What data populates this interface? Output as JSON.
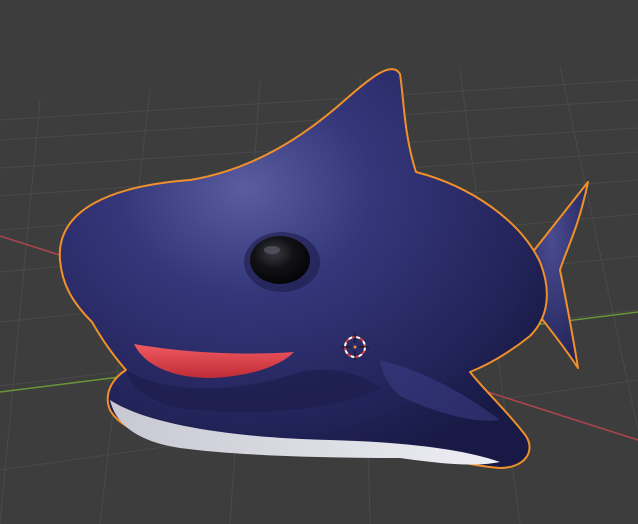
{
  "viewport": {
    "background_color": "#3d3d3d",
    "grid_color": "#4a4a4a",
    "x_axis_color": "#b1454d",
    "y_axis_color": "#6a9638",
    "selection_outline_color": "#f0902a"
  },
  "scene": {
    "object": "shark-model",
    "body_color": "#2a2b66",
    "mouth_color": "#e0404a",
    "belly_color": "#dcdce4",
    "eye_color": "#101014",
    "selected": true
  },
  "cursor": {
    "icon": "3d-cursor-icon",
    "ring_color_a": "#e04040",
    "ring_color_b": "#ffffff"
  }
}
